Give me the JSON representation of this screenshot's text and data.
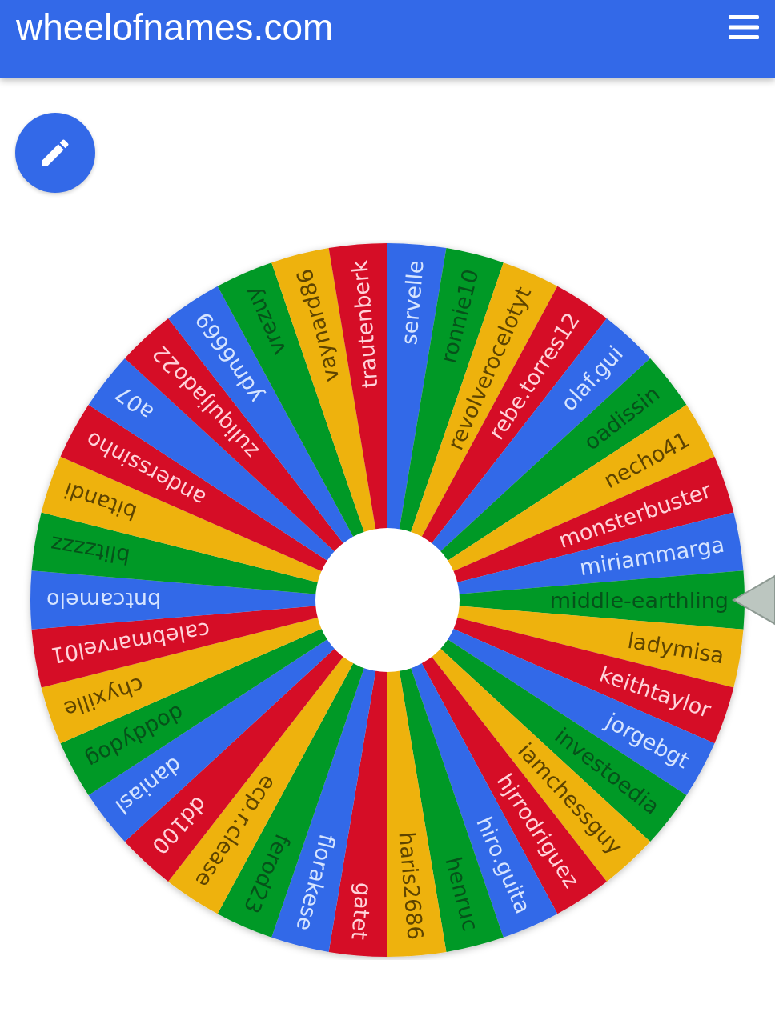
{
  "header": {
    "title": "wheelofnames.com"
  },
  "wheel": {
    "segments": [
      {
        "name": "servelle",
        "color": "#3369e8"
      },
      {
        "name": "ronnie10",
        "color": "#009925"
      },
      {
        "name": "revolverocelotyt",
        "color": "#eeb211"
      },
      {
        "name": "rebe.torres12",
        "color": "#d50f25"
      },
      {
        "name": "olaf.gui",
        "color": "#3369e8"
      },
      {
        "name": "oadissin",
        "color": "#009925"
      },
      {
        "name": "necho41",
        "color": "#eeb211"
      },
      {
        "name": "monsterbuster",
        "color": "#d50f25"
      },
      {
        "name": "miriammarga",
        "color": "#3369e8"
      },
      {
        "name": "middle-earthling",
        "color": "#009925"
      },
      {
        "name": "ladymisa",
        "color": "#eeb211"
      },
      {
        "name": "keithtaylor",
        "color": "#d50f25"
      },
      {
        "name": "jorgebgt",
        "color": "#3369e8"
      },
      {
        "name": "investoedia",
        "color": "#009925"
      },
      {
        "name": "iamchessguy",
        "color": "#eeb211"
      },
      {
        "name": "hjrrodriguez",
        "color": "#d50f25"
      },
      {
        "name": "hiro.guita",
        "color": "#3369e8"
      },
      {
        "name": "henruc",
        "color": "#009925"
      },
      {
        "name": "haris2686",
        "color": "#eeb211"
      },
      {
        "name": "gatet",
        "color": "#d50f25"
      },
      {
        "name": "florakese",
        "color": "#3369e8"
      },
      {
        "name": "ferod23",
        "color": "#009925"
      },
      {
        "name": "ecp.r.clease",
        "color": "#eeb211"
      },
      {
        "name": "dd100",
        "color": "#d50f25"
      },
      {
        "name": "daniasl",
        "color": "#3369e8"
      },
      {
        "name": "doddydog",
        "color": "#009925"
      },
      {
        "name": "chyxille",
        "color": "#eeb211"
      },
      {
        "name": "calebmarvel01",
        "color": "#d50f25"
      },
      {
        "name": "bntcamelo",
        "color": "#3369e8"
      },
      {
        "name": "blitzzzz",
        "color": "#009925"
      },
      {
        "name": "bitandi",
        "color": "#eeb211"
      },
      {
        "name": "anderssinho",
        "color": "#d50f25"
      },
      {
        "name": "a07",
        "color": "#3369e8"
      },
      {
        "name": "zuliquljado22",
        "color": "#d50f25"
      },
      {
        "name": "ydm6669",
        "color": "#3369e8"
      },
      {
        "name": "vrezuy",
        "color": "#009925"
      },
      {
        "name": "vaynard86",
        "color": "#eeb211"
      },
      {
        "name": "trautenberk",
        "color": "#d50f25"
      }
    ]
  }
}
